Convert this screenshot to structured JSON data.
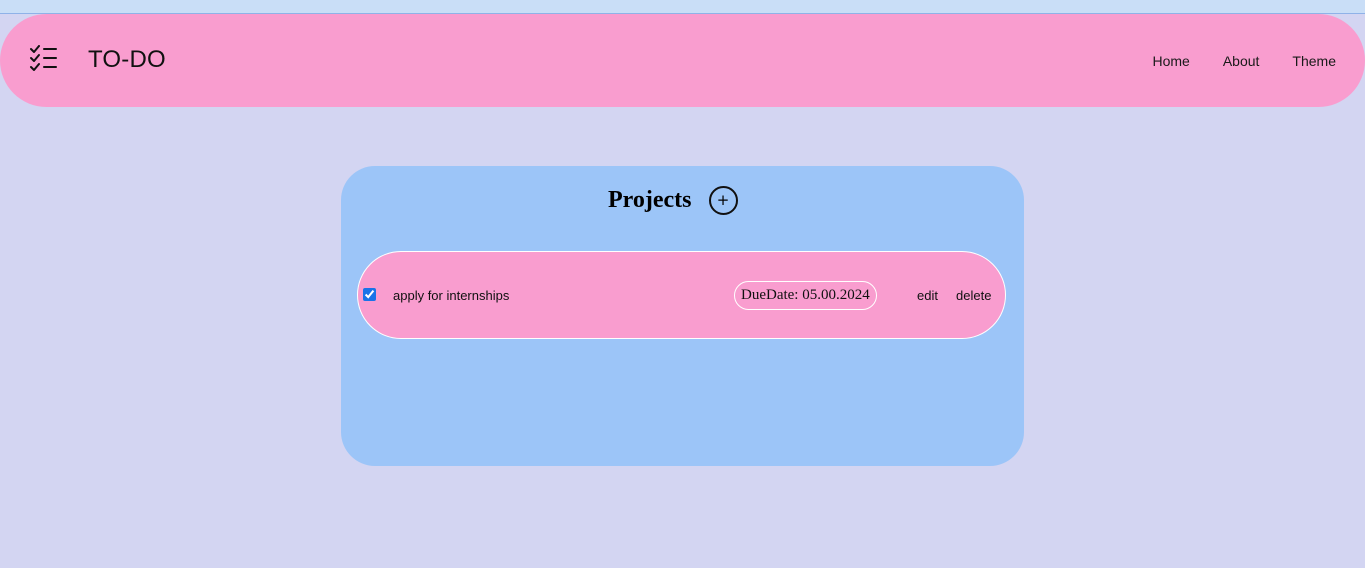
{
  "colors": {
    "page_background": "#d3d5f2",
    "navbar": "#f99dcf",
    "panel": "#9cc5f8",
    "task_row": "#f99dcf",
    "border": "#ffffff"
  },
  "header": {
    "logo_icon": "checklist-icon",
    "title": "TO-DO",
    "nav": {
      "home": "Home",
      "about": "About",
      "theme": "Theme"
    }
  },
  "projects": {
    "title": "Projects",
    "add_label": "+",
    "tasks": [
      {
        "checked": true,
        "label": "apply for internships",
        "due_date": "DueDate: 05.00.2024",
        "edit_label": "edit",
        "delete_label": "delete"
      }
    ]
  }
}
